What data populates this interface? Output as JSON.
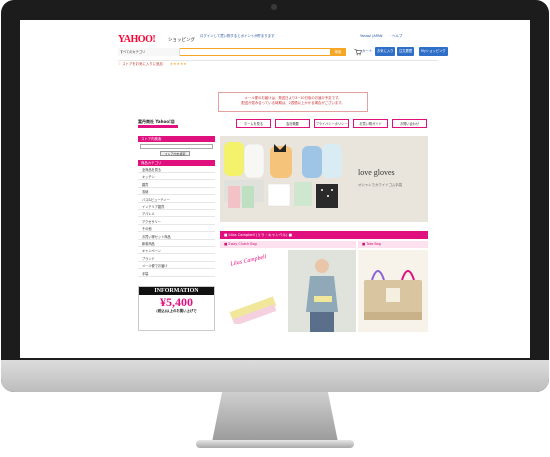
{
  "header": {
    "logo": "YAHOO!",
    "logo_sub": "JAPAN",
    "shop_label": "ショッピング",
    "category_select": "すべてのカテゴリ",
    "search_button": "検索",
    "links": [
      "カート",
      "お気に入り",
      "注文履歴",
      "Myショッピング"
    ],
    "top_right": "Yahoo! JAPAN"
  },
  "notice": {
    "line1": "メール便のお届けは、発送日より3~10日後のお届け予定です。",
    "line2": "配送が混み合っている時期は、2週間以上かかる場合がございます。"
  },
  "shop": {
    "name": "富丹商社 Yahoo!店",
    "nav": [
      "ホームを見る",
      "会社概要",
      "プライバシーポリシー",
      "お買い物ガイド",
      "お問い合わせ"
    ]
  },
  "sidebar": {
    "search_head": "ストア内検索",
    "search_button": "ストア内を検索",
    "category_head": "商品カテゴリ",
    "categories": [
      "全商品を見る",
      "キッチン",
      "雑貨",
      "収納",
      "バス&ビューティー",
      "インテリア雑貨",
      "アパレル",
      "アクセサリー",
      "その他",
      "お買い得セット商品",
      "新着商品",
      "キャンペーン",
      "ブランド",
      "メール便でお届け",
      "手袋"
    ],
    "info_title": "INFORMATION",
    "info_price": "¥5,400",
    "info_note": "(税込)以上のお買い上げで"
  },
  "main": {
    "banner_title": "love gloves",
    "banner_sub": "オシャレでカワイイゴム手袋",
    "brand_bar": "■ Lilas Campbell (リラ・キャンベル) ■",
    "sub_bars": [
      "■ 2way Clutch Bag",
      "■ Tote Bag"
    ],
    "brand_logo": "Lilas Campbell"
  }
}
